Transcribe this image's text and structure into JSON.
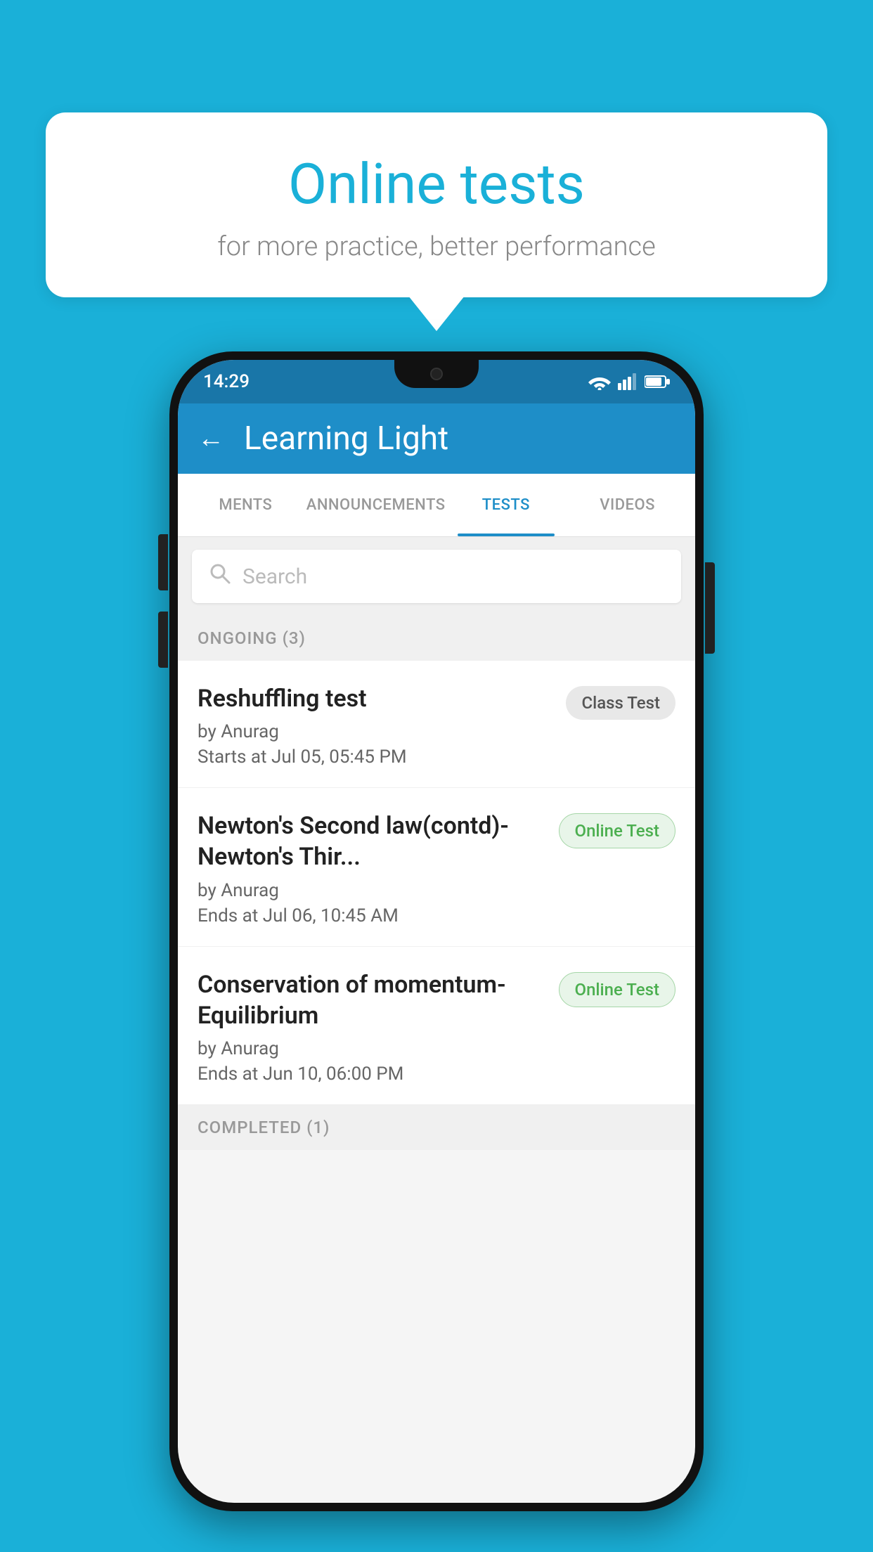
{
  "background_color": "#1ab0d8",
  "bubble": {
    "title": "Online tests",
    "subtitle": "for more practice, better performance"
  },
  "phone": {
    "status_bar": {
      "time": "14:29",
      "wifi": "▼",
      "signal": "▲",
      "battery": "▮"
    },
    "app_bar": {
      "back_label": "←",
      "title": "Learning Light"
    },
    "tabs": [
      {
        "label": "MENTS",
        "active": false
      },
      {
        "label": "ANNOUNCEMENTS",
        "active": false
      },
      {
        "label": "TESTS",
        "active": true
      },
      {
        "label": "VIDEOS",
        "active": false
      }
    ],
    "search": {
      "placeholder": "Search",
      "icon": "🔍"
    },
    "section_ongoing": {
      "label": "ONGOING (3)"
    },
    "tests": [
      {
        "name": "Reshuffling test",
        "by": "by Anurag",
        "time_label": "Starts at",
        "time": "Jul 05, 05:45 PM",
        "badge": "Class Test",
        "badge_type": "class"
      },
      {
        "name": "Newton's Second law(contd)-Newton's Thir...",
        "by": "by Anurag",
        "time_label": "Ends at",
        "time": "Jul 06, 10:45 AM",
        "badge": "Online Test",
        "badge_type": "online"
      },
      {
        "name": "Conservation of momentum-Equilibrium",
        "by": "by Anurag",
        "time_label": "Ends at",
        "time": "Jun 10, 06:00 PM",
        "badge": "Online Test",
        "badge_type": "online"
      }
    ],
    "section_completed": {
      "label": "COMPLETED (1)"
    }
  }
}
